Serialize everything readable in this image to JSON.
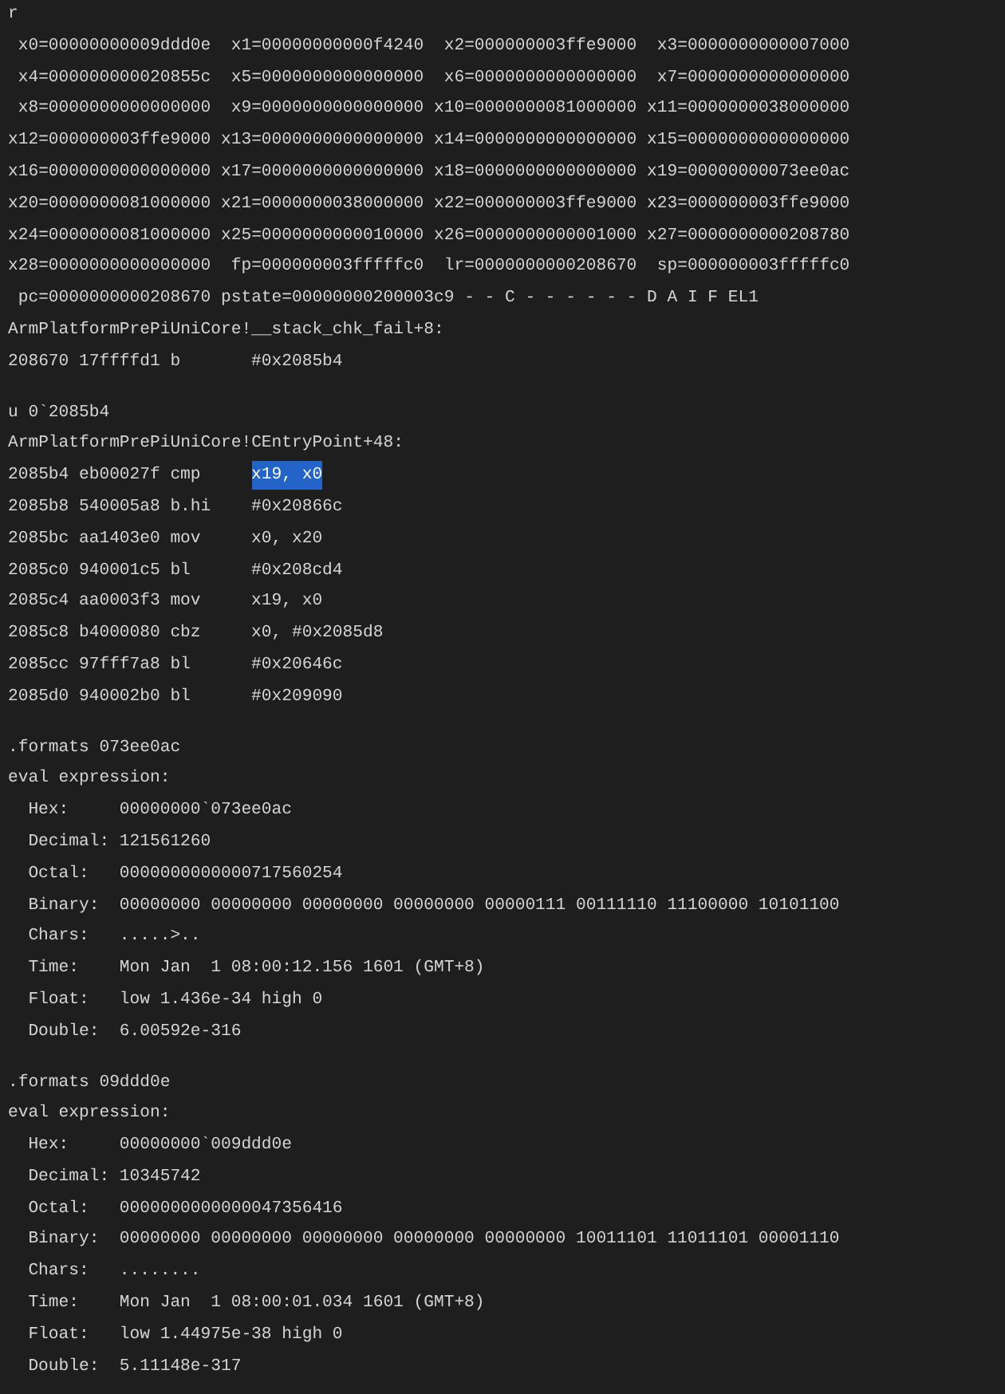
{
  "console_lines": [
    {
      "kind": "text",
      "text": "r"
    },
    {
      "kind": "text",
      "text": " x0=00000000009ddd0e  x1=00000000000f4240  x2=000000003ffe9000  x3=0000000000007000"
    },
    {
      "kind": "text",
      "text": " x4=000000000020855c  x5=0000000000000000  x6=0000000000000000  x7=0000000000000000"
    },
    {
      "kind": "text",
      "text": " x8=0000000000000000  x9=0000000000000000 x10=0000000081000000 x11=0000000038000000"
    },
    {
      "kind": "text",
      "text": "x12=000000003ffe9000 x13=0000000000000000 x14=0000000000000000 x15=0000000000000000"
    },
    {
      "kind": "text",
      "text": "x16=0000000000000000 x17=0000000000000000 x18=0000000000000000 x19=00000000073ee0ac"
    },
    {
      "kind": "text",
      "text": "x20=0000000081000000 x21=0000000038000000 x22=000000003ffe9000 x23=000000003ffe9000"
    },
    {
      "kind": "text",
      "text": "x24=0000000081000000 x25=0000000000010000 x26=0000000000001000 x27=0000000000208780"
    },
    {
      "kind": "text",
      "text": "x28=0000000000000000  fp=000000003fffffc0  lr=0000000000208670  sp=000000003fffffc0"
    },
    {
      "kind": "text",
      "text": " pc=0000000000208670 pstate=00000000200003c9 - - C - - - - - - D A I F EL1"
    },
    {
      "kind": "text",
      "text": "ArmPlatformPrePiUniCore!__stack_chk_fail+8:"
    },
    {
      "kind": "instruction",
      "address": "208670",
      "opcode": "17ffffd1",
      "mnemonic": "b",
      "operands": "#0x2085b4",
      "selected": false
    },
    {
      "kind": "spacer"
    },
    {
      "kind": "text",
      "text": "u 0`2085b4"
    },
    {
      "kind": "text",
      "text": "ArmPlatformPrePiUniCore!CEntryPoint+48:"
    },
    {
      "kind": "instruction",
      "address": "2085b4",
      "opcode": "eb00027f",
      "mnemonic": "cmp",
      "operands": "x19, x0",
      "selected": true
    },
    {
      "kind": "instruction",
      "address": "2085b8",
      "opcode": "540005a8",
      "mnemonic": "b.hi",
      "operands": "#0x20866c",
      "selected": false
    },
    {
      "kind": "instruction",
      "address": "2085bc",
      "opcode": "aa1403e0",
      "mnemonic": "mov",
      "operands": "x0, x20",
      "selected": false
    },
    {
      "kind": "instruction",
      "address": "2085c0",
      "opcode": "940001c5",
      "mnemonic": "bl",
      "operands": "#0x208cd4",
      "selected": false
    },
    {
      "kind": "instruction",
      "address": "2085c4",
      "opcode": "aa0003f3",
      "mnemonic": "mov",
      "operands": "x19, x0",
      "selected": false
    },
    {
      "kind": "instruction",
      "address": "2085c8",
      "opcode": "b4000080",
      "mnemonic": "cbz",
      "operands": "x0, #0x2085d8",
      "selected": false
    },
    {
      "kind": "instruction",
      "address": "2085cc",
      "opcode": "97fff7a8",
      "mnemonic": "bl",
      "operands": "#0x20646c",
      "selected": false
    },
    {
      "kind": "instruction",
      "address": "2085d0",
      "opcode": "940002b0",
      "mnemonic": "bl",
      "operands": "#0x209090",
      "selected": false
    },
    {
      "kind": "spacer"
    },
    {
      "kind": "text",
      "text": ".formats 073ee0ac"
    },
    {
      "kind": "text",
      "text": "eval expression:"
    },
    {
      "kind": "field",
      "label": "Hex:",
      "value": "00000000`073ee0ac"
    },
    {
      "kind": "field",
      "label": "Decimal:",
      "value": "121561260"
    },
    {
      "kind": "field",
      "label": "Octal:",
      "value": "0000000000000717560254"
    },
    {
      "kind": "field",
      "label": "Binary:",
      "value": "00000000 00000000 00000000 00000000 00000111 00111110 11100000 10101100"
    },
    {
      "kind": "field",
      "label": "Chars:",
      "value": ".....>.."
    },
    {
      "kind": "field",
      "label": "Time:",
      "value": "Mon Jan  1 08:00:12.156 1601 (GMT+8)"
    },
    {
      "kind": "field",
      "label": "Float:",
      "value": "low 1.436e-34 high 0"
    },
    {
      "kind": "field",
      "label": "Double:",
      "value": "6.00592e-316"
    },
    {
      "kind": "spacer"
    },
    {
      "kind": "text",
      "text": ".formats 09ddd0e"
    },
    {
      "kind": "text",
      "text": "eval expression:"
    },
    {
      "kind": "field",
      "label": "Hex:",
      "value": "00000000`009ddd0e"
    },
    {
      "kind": "field",
      "label": "Decimal:",
      "value": "10345742"
    },
    {
      "kind": "field",
      "label": "Octal:",
      "value": "0000000000000047356416"
    },
    {
      "kind": "field",
      "label": "Binary:",
      "value": "00000000 00000000 00000000 00000000 00000000 10011101 11011101 00001110"
    },
    {
      "kind": "field",
      "label": "Chars:",
      "value": "........"
    },
    {
      "kind": "field",
      "label": "Time:",
      "value": "Mon Jan  1 08:00:01.034 1601 (GMT+8)"
    },
    {
      "kind": "field",
      "label": "Float:",
      "value": "low 1.44975e-38 high 0"
    },
    {
      "kind": "field",
      "label": "Double:",
      "value": "5.11148e-317"
    }
  ]
}
